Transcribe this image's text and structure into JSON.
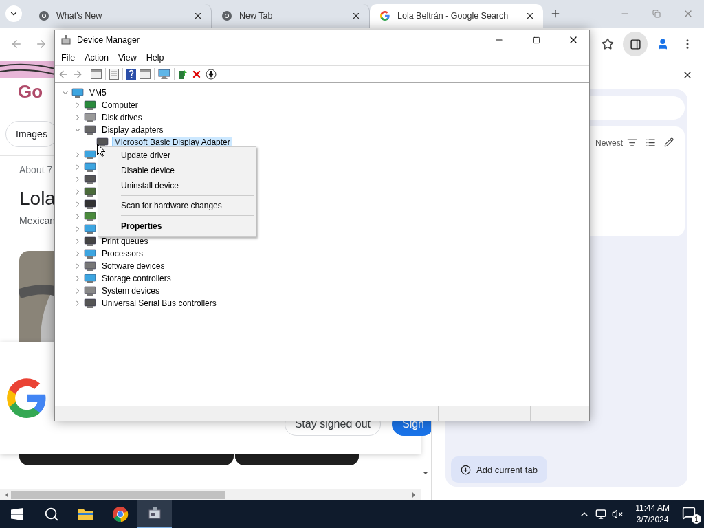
{
  "browser": {
    "tabs": [
      {
        "title": "What's New",
        "selected": false
      },
      {
        "title": "New Tab",
        "selected": false
      },
      {
        "title": "Lola Beltrán - Google Search",
        "selected": true
      }
    ]
  },
  "page": {
    "logo_text": "Go",
    "filters": [
      "Images"
    ],
    "result_count": "About 7",
    "heading": "Lola",
    "subheading": "Mexican"
  },
  "sign_in_prompt": {
    "buttons": [
      {
        "label": "Stay signed out",
        "kind": "secondary"
      },
      {
        "label": "Sign",
        "kind": "primary"
      }
    ]
  },
  "side_panel": {
    "sort_label": "Newest",
    "add_button": "Add current tab"
  },
  "device_manager": {
    "title": "Device Manager",
    "menu": [
      "File",
      "Action",
      "View",
      "Help"
    ],
    "tree": {
      "label": "VM5",
      "expanded": true,
      "selected": false,
      "children": [
        {
          "label": "Computer",
          "expanded": false,
          "selected": false
        },
        {
          "label": "Disk drives",
          "expanded": false,
          "selected": false
        },
        {
          "label": "Display adapters",
          "expanded": true,
          "selected": false,
          "children": [
            {
              "label": "Microsoft Basic Display Adapter",
              "selected": true
            }
          ]
        },
        {
          "expanded": false
        },
        {
          "expanded": false
        },
        {
          "expanded": false
        },
        {
          "expanded": false
        },
        {
          "expanded": false
        },
        {
          "expanded": false
        },
        {
          "expanded": false
        },
        {
          "label": "Print queues",
          "expanded": false,
          "selected": false
        },
        {
          "label": "Processors",
          "expanded": false,
          "selected": false
        },
        {
          "label": "Software devices",
          "expanded": false,
          "selected": false
        },
        {
          "label": "Storage controllers",
          "expanded": false,
          "selected": false
        },
        {
          "label": "System devices",
          "expanded": false,
          "selected": false
        },
        {
          "label": "Universal Serial Bus controllers",
          "expanded": false,
          "selected": false
        }
      ]
    }
  },
  "context_menu": {
    "items": [
      {
        "kind": "item",
        "label": "Update driver"
      },
      {
        "kind": "item",
        "label": "Disable device"
      },
      {
        "kind": "item",
        "label": "Uninstall device"
      },
      {
        "kind": "separator"
      },
      {
        "kind": "item",
        "label": "Scan for hardware changes"
      },
      {
        "kind": "separator"
      },
      {
        "kind": "default",
        "label": "Properties"
      }
    ]
  },
  "taskbar": {
    "time": "11:44 AM",
    "date": "3/7/2024",
    "notifications": "1"
  }
}
